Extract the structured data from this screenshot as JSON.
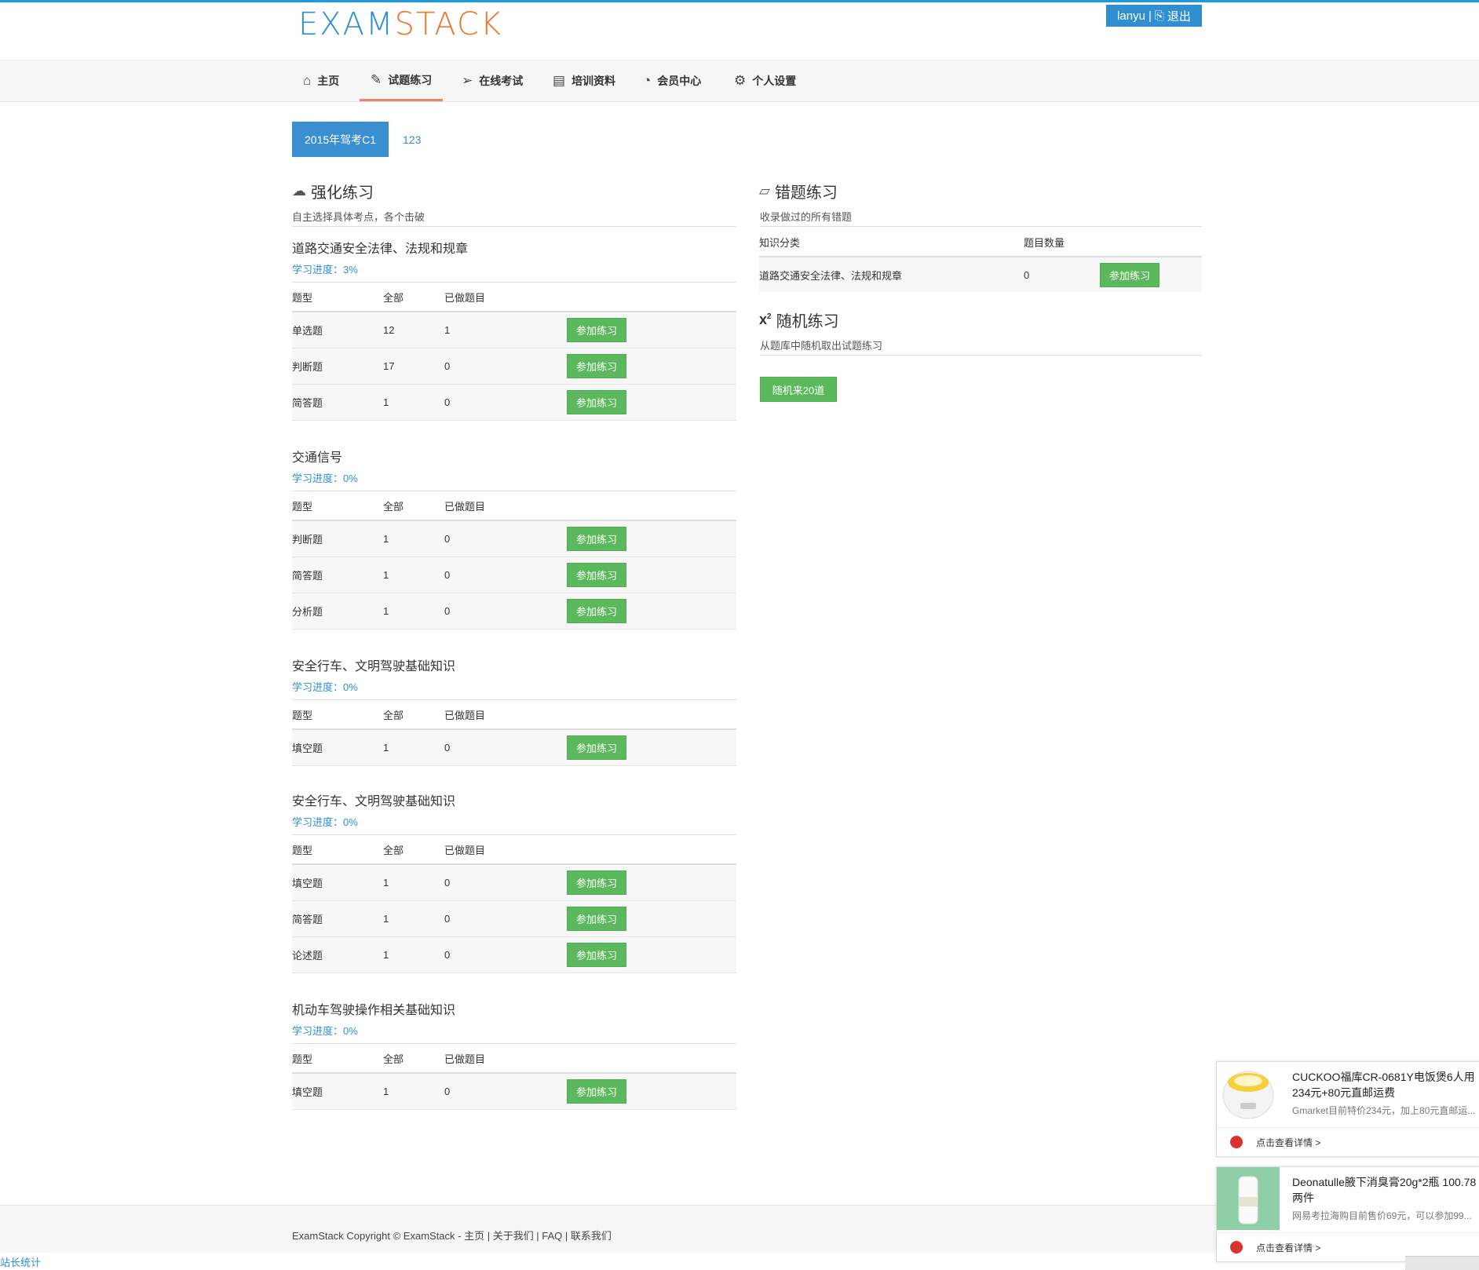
{
  "brand": {
    "logo_part1": "EXAM",
    "logo_part2": "STACK",
    "logo_color1": "#2f8fd1",
    "logo_color2": "#e8792f"
  },
  "user": {
    "name": "lanyu",
    "separator": "|",
    "logout_icon": "sign-out-icon",
    "logout": "退出"
  },
  "nav": [
    {
      "icon": "home-icon",
      "label": "主页"
    },
    {
      "icon": "edit-icon",
      "label": "试题练习"
    },
    {
      "icon": "paper-plane-icon",
      "label": "在线考试"
    },
    {
      "icon": "book-icon",
      "label": "培训资料"
    },
    {
      "icon": "dashboard-icon",
      "label": "会员中心"
    },
    {
      "icon": "gears-icon",
      "label": "个人设置"
    }
  ],
  "tabs": [
    "2015年驾考C1",
    "123"
  ],
  "practice": {
    "title": "强化练习",
    "subtitle": "自主选择具体考点，各个击破",
    "headers": [
      "题型",
      "全部",
      "已做题目"
    ],
    "button": "参加练习",
    "categories": [
      {
        "title": "道路交通安全法律、法规和规章",
        "progress": "学习进度：3%",
        "rows": [
          [
            "单选题",
            "12",
            "1"
          ],
          [
            "判断题",
            "17",
            "0"
          ],
          [
            "简答题",
            "1",
            "0"
          ]
        ]
      },
      {
        "title": "交通信号",
        "progress": "学习进度：0%",
        "rows": [
          [
            "判断题",
            "1",
            "0"
          ],
          [
            "简答题",
            "1",
            "0"
          ],
          [
            "分析题",
            "1",
            "0"
          ]
        ]
      },
      {
        "title": "安全行车、文明驾驶基础知识",
        "progress": "学习进度：0%",
        "rows": [
          [
            "填空题",
            "1",
            "0"
          ]
        ]
      },
      {
        "title": "安全行车、文明驾驶基础知识",
        "progress": "学习进度：0%",
        "rows": [
          [
            "填空题",
            "1",
            "0"
          ],
          [
            "简答题",
            "1",
            "0"
          ],
          [
            "论述题",
            "1",
            "0"
          ]
        ]
      },
      {
        "title": "机动车驾驶操作相关基础知识",
        "progress": "学习进度：0%",
        "rows": [
          [
            "填空题",
            "1",
            "0"
          ]
        ]
      }
    ]
  },
  "wrong": {
    "title": "错题练习",
    "subtitle": "收录做过的所有错题",
    "headers": [
      "知识分类",
      "题目数量"
    ],
    "rows": [
      [
        "道路交通安全法律、法规和规章",
        "0"
      ]
    ],
    "button": "参加练习"
  },
  "random": {
    "title": "随机练习",
    "subtitle": "从题库中随机取出试题练习",
    "button": "随机来20道"
  },
  "footer": {
    "text": "ExamStack Copyright © ExamStack - 主页 | 关于我们 | FAQ | 联系我们"
  },
  "stats_link": "站长统计",
  "ads": [
    {
      "title": "CUCKOO福库CR-0681Y电饭煲6人用 234元+80元直邮运费",
      "desc": "Gmarket目前特价234元，加上80元直邮运...",
      "link": "点击查看详情 >"
    },
    {
      "title": "Deonatulle腋下消臭膏20g*2瓶 100.78两件",
      "desc": "网易考拉海购目前售价69元，可以参加99...",
      "link": "点击查看详情 >"
    }
  ]
}
